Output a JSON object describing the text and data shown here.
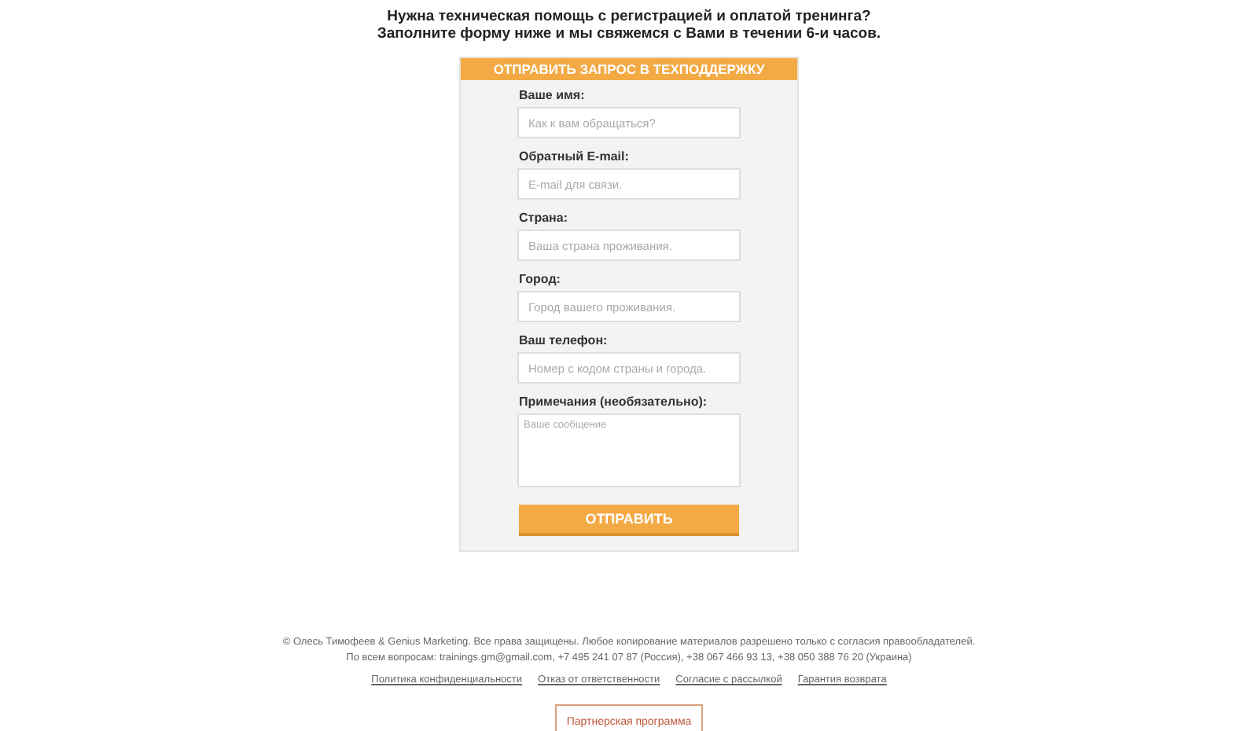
{
  "heading": [
    "Нужна техническая помощь с регистрацией и оплатой тренинга?",
    "Заполните форму ниже и мы свяжемся с Вами в течении 6-и часов."
  ],
  "form": {
    "title": "ОТПРАВИТЬ ЗАПРОС В ТЕХПОДДЕРЖКУ",
    "fields": [
      {
        "kind": "input",
        "label": "Ваше имя:",
        "placeholder": "Как к вам обращаться?"
      },
      {
        "kind": "input",
        "label": "Обратный E-mail:",
        "placeholder": "E-mail для связи."
      },
      {
        "kind": "input",
        "label": "Страна:",
        "placeholder": "Ваша страна проживания."
      },
      {
        "kind": "input",
        "label": "Город:",
        "placeholder": "Город вашего проживания."
      },
      {
        "kind": "input",
        "label": "Ваш телефон:",
        "placeholder": "Номер с кодом страны и города."
      },
      {
        "kind": "textarea",
        "label": "Примечания (необязательно):",
        "placeholder": "Ваше сообщение"
      }
    ],
    "submit": "ОТПРАВИТЬ"
  },
  "footer": {
    "copyright": "© Олесь Тимофеев & Genius Marketing. Все права защищены. Любое копирование материалов разрешено только с согласия правообладателей.",
    "contacts": "По всем вопросам: trainings.gm@gmail.com, +7 495 241 07 87 (Россия), +38 067 466 93 13, +38 050 388 76 20 (Украина)",
    "links": [
      "Политика конфиденциальности",
      "Отказ от ответственности",
      "Согласие с рассылкой",
      "Гарантия возврата"
    ],
    "partner_button": "Партнерская программа"
  }
}
